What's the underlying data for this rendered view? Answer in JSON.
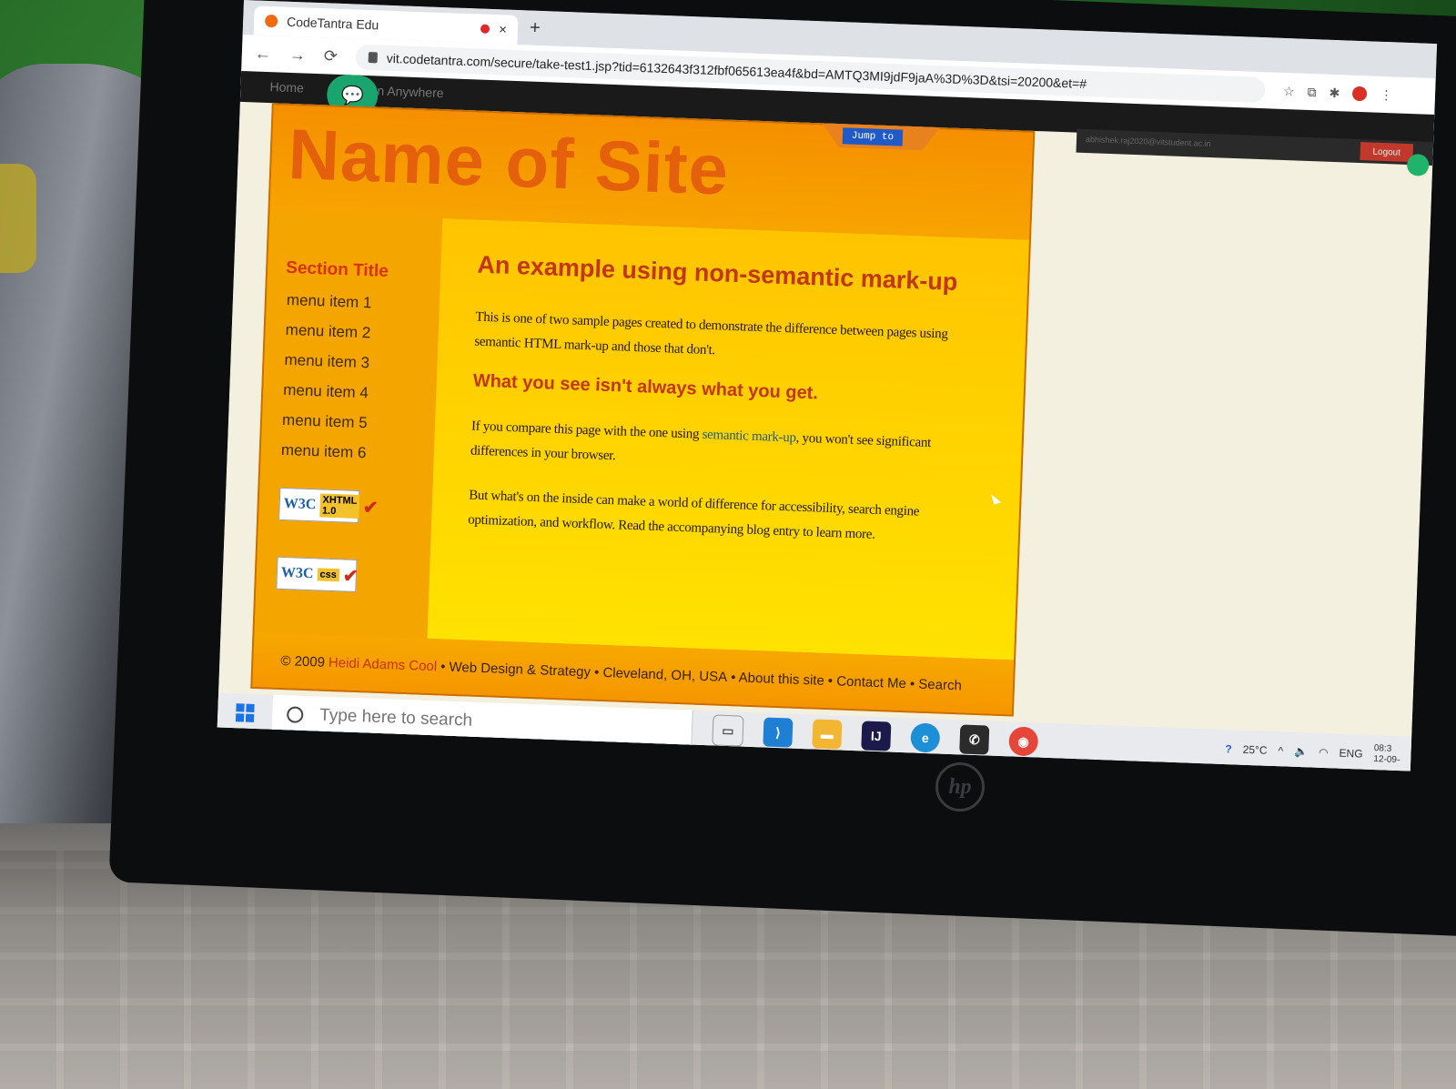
{
  "browser": {
    "tab_title": "CodeTantra Edu",
    "tab_close": "×",
    "new_tab": "+",
    "back": "←",
    "forward": "→",
    "reload": "⟳",
    "url": "vit.codetantra.com/secure/take-test1.jsp?tid=6132643f312fbf065613ea4f&bd=AMTQ3MI9jdF9jaA%3D%3D&tsi=20200&et=#",
    "toolbar_icons": [
      "☆",
      "⧉",
      "✱",
      "⋮"
    ]
  },
  "exam_bar": {
    "home_label": "Home",
    "anywhere_label": "n Anywhere",
    "jump_label": "Jump to",
    "user_email": "abhishek.raj2020@vitstudent.ac.in",
    "logout_label": "Logout"
  },
  "site": {
    "title": "Name of Site",
    "sidebar": {
      "section_title": "Section Title",
      "menu": [
        "menu item 1",
        "menu item 2",
        "menu item 3",
        "menu item 4",
        "menu item 5",
        "menu item 6"
      ],
      "badges": [
        {
          "logo": "W3C",
          "label": "XHTML 1.0"
        },
        {
          "logo": "W3C",
          "label": "css"
        }
      ]
    },
    "content": {
      "heading": "An example using non-semantic mark-up",
      "para1": "This is one of two sample pages created to demonstrate the difference between pages using semantic HTML mark-up and those that don't.",
      "subheading": "What you see isn't always what you get.",
      "para2_before": "If you compare this page with the one using ",
      "para2_link": "semantic mark-up",
      "para2_after": ", you won't see significant differences in your browser.",
      "para3": "But what's on the inside can make a world of difference for accessibility, search engine optimization, and workflow. Read the accompanying blog entry to learn more."
    },
    "footer": {
      "copyright": "© 2009",
      "author": "Heidi Adams Cool",
      "items": [
        "• Web Design & Strategy",
        "• Cleveland, OH, USA",
        "• About this site",
        "• Contact Me",
        "• Search"
      ]
    }
  },
  "taskbar": {
    "search_placeholder": "Type here to search",
    "apps": [
      "task-view",
      "vscode",
      "file-explorer",
      "intellij",
      "edge",
      "whatsapp",
      "chrome"
    ],
    "temperature": "25°C",
    "language": "ENG",
    "time": "08:3",
    "date": "12-09-"
  },
  "laptop": {
    "brand": "hp"
  },
  "colors": {
    "site_orange": "#f59a00",
    "site_yellow": "#ffe200",
    "heading_red": "#c23612",
    "taskbar_bg": "#e9eaee"
  }
}
